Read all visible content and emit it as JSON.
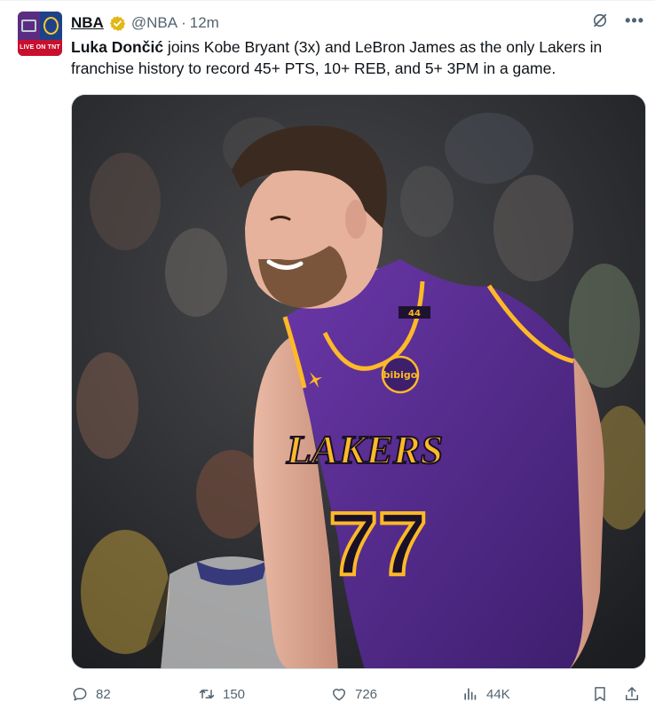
{
  "account": {
    "display_name": "NBA",
    "handle": "@NBA",
    "separator": "·",
    "time": "12m",
    "avatar_caption": "LIVE ON TNT"
  },
  "tweet": {
    "name_bold": "Luka Dončić",
    "text_rest": " joins Kobe Bryant (3x) and LeBron James as the only Lakers in franchise history to record 45+ PTS, 10+ REB, and 5+ 3PM in a game."
  },
  "media": {
    "jersey_wordmark": "LAKERS",
    "jersey_number": "77",
    "sponsor_patch": "bibigo",
    "strap_number": "44"
  },
  "metrics": {
    "replies": "82",
    "reposts": "150",
    "likes": "726",
    "views": "44K"
  },
  "colors": {
    "verified_gold": "#e2b719",
    "lakers_purple": "#552583",
    "lakers_gold": "#fdb927",
    "muted_text": "#536471"
  }
}
